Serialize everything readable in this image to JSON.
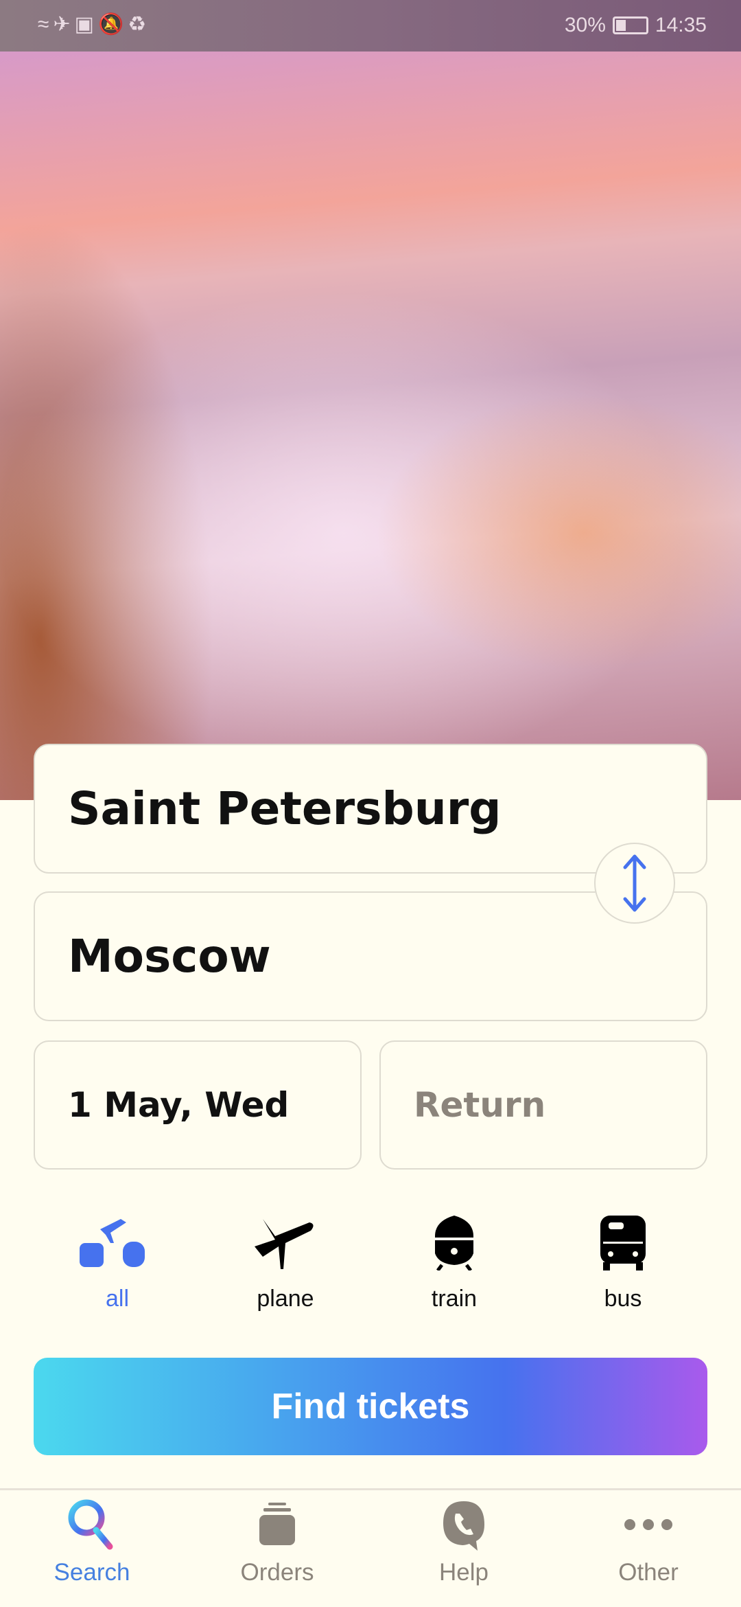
{
  "status_bar": {
    "battery": "30%",
    "battery_level": 0.3,
    "time": "14:35",
    "icons": [
      "wifi-icon",
      "airplane-icon",
      "cast-icon",
      "mute-bell-icon",
      "sync-icon"
    ]
  },
  "search": {
    "from": "Saint Petersburg",
    "to": "Moscow",
    "depart_date": "1 May, Wed",
    "return_placeholder": "Return"
  },
  "modes": [
    {
      "label": "all",
      "active": true
    },
    {
      "label": "plane",
      "active": false
    },
    {
      "label": "train",
      "active": false
    },
    {
      "label": "bus",
      "active": false
    }
  ],
  "find_button": "Find tickets",
  "nav": [
    {
      "label": "Search",
      "active": true
    },
    {
      "label": "Orders"
    },
    {
      "label": "Help"
    },
    {
      "label": "Other"
    }
  ],
  "colors": {
    "accent": "#4672ee",
    "inactive": "#8b847b",
    "background": "#fffdf0"
  }
}
